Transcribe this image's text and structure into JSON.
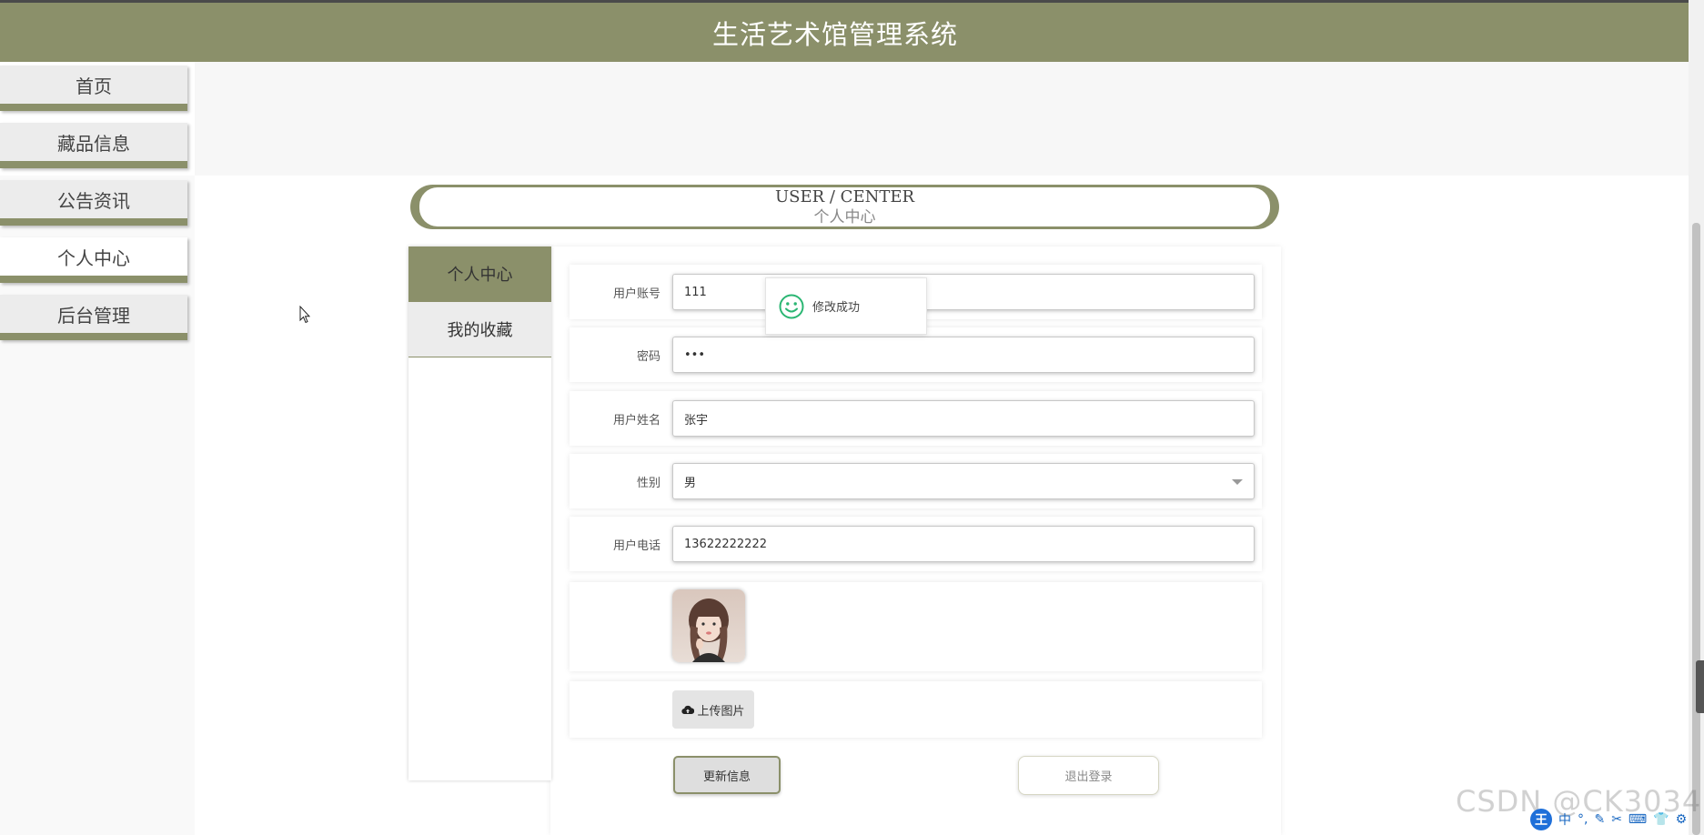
{
  "header": {
    "title": "生活艺术馆管理系统"
  },
  "nav": {
    "items": [
      {
        "label": "首页"
      },
      {
        "label": "藏品信息"
      },
      {
        "label": "公告资讯"
      },
      {
        "label": "个人中心"
      },
      {
        "label": "后台管理"
      }
    ],
    "active_index": 3
  },
  "banner": {
    "en": "USER / CENTER",
    "cn": "个人中心"
  },
  "side_menu": {
    "items": [
      {
        "label": "个人中心"
      },
      {
        "label": "我的收藏"
      }
    ]
  },
  "form": {
    "account": {
      "label": "用户账号",
      "value": "111"
    },
    "password": {
      "label": "密码",
      "value": "•••"
    },
    "name": {
      "label": "用户姓名",
      "value": "张宇"
    },
    "gender": {
      "label": "性别",
      "value": "男"
    },
    "phone": {
      "label": "用户电话",
      "value": "13622222222"
    }
  },
  "upload": {
    "label": "上传图片",
    "icon": "cloud-upload-icon"
  },
  "buttons": {
    "update": "更新信息",
    "logout": "退出登录"
  },
  "toast": {
    "message": "修改成功",
    "icon": "smile-icon",
    "color": "#2bb673"
  },
  "watermark": {
    "text": "CSDN @CK3034"
  },
  "ime": {
    "logo": "王",
    "items": [
      "中",
      "°,",
      "✎",
      "✂",
      "⌨",
      "👕",
      "⚙"
    ]
  },
  "colors": {
    "accent": "#8b906a"
  }
}
